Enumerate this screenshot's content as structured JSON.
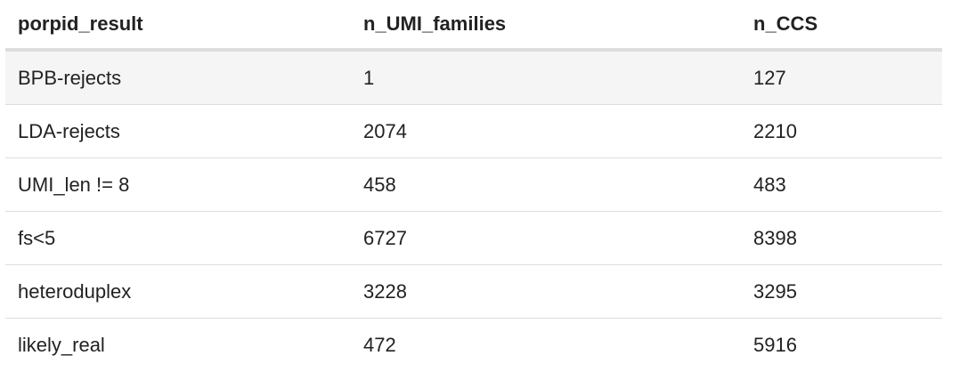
{
  "table": {
    "columns": [
      "porpid_result",
      "n_UMI_families",
      "n_CCS"
    ],
    "rows": [
      [
        "BPB-rejects",
        "1",
        "127"
      ],
      [
        "LDA-rejects",
        "2074",
        "2210"
      ],
      [
        "UMI_len != 8",
        "458",
        "483"
      ],
      [
        "fs<5",
        "6727",
        "8398"
      ],
      [
        "heteroduplex",
        "3228",
        "3295"
      ],
      [
        "likely_real",
        "472",
        "5916"
      ]
    ]
  },
  "colors": {
    "header_rule": "#dddddd",
    "row_rule": "#dddddd",
    "stripe": "#f5f5f5",
    "text": "#222222"
  }
}
